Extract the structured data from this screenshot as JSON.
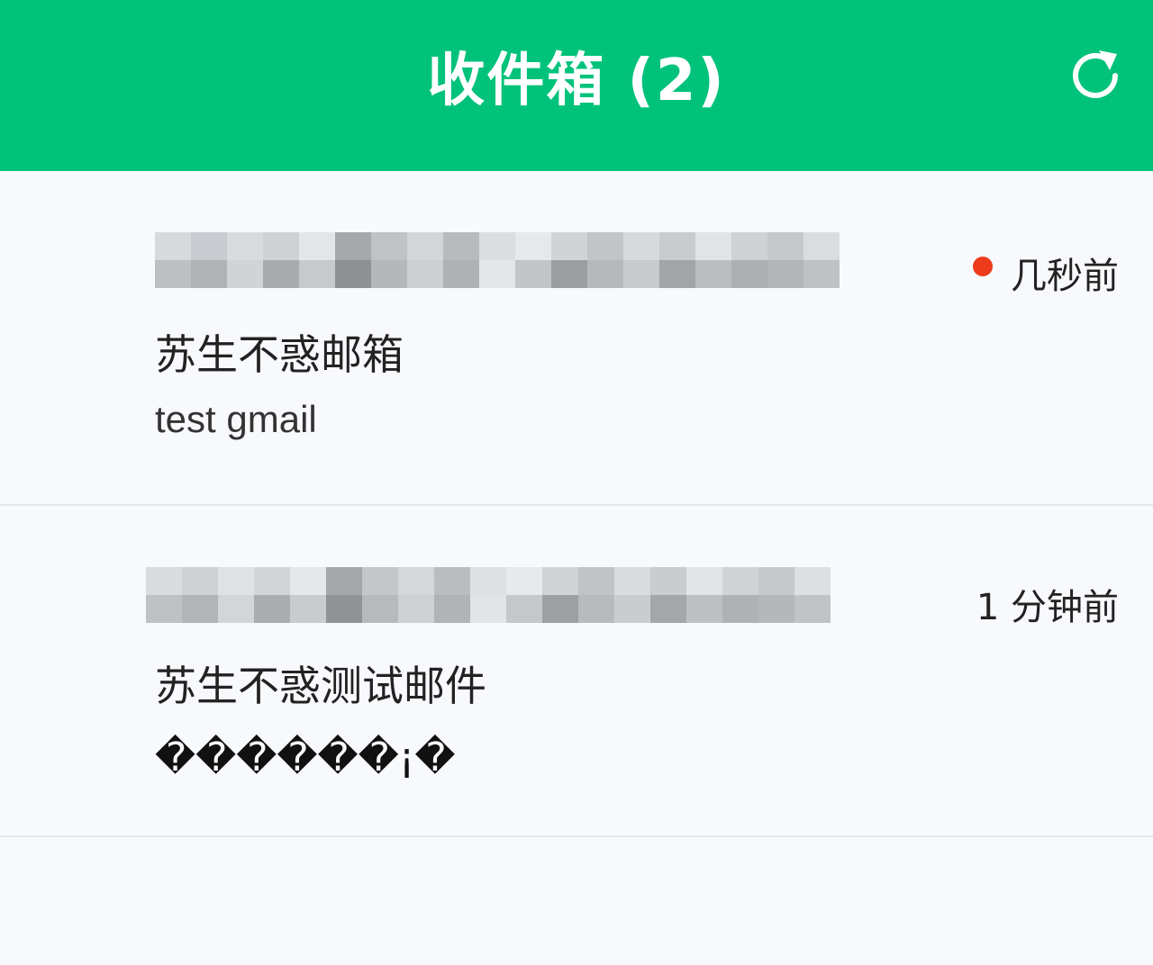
{
  "header": {
    "title": "收件箱 (2)",
    "background_color": "#00c27a",
    "refresh_icon": "refresh-icon"
  },
  "messages": [
    {
      "sender": "xiangxxxxxxxxxxxxxxxxxxxn",
      "subject": "苏生不惑邮箱",
      "preview": "test gmail",
      "time": "几秒前",
      "unread": true,
      "unread_color": "#ee3b1c"
    },
    {
      "sender": "xixxxxxxxxxxxxxxxxxxxxxxl",
      "subject": "苏生不惑测试邮件",
      "preview": "������¡�",
      "time": "1 分钟前",
      "unread": false
    }
  ]
}
